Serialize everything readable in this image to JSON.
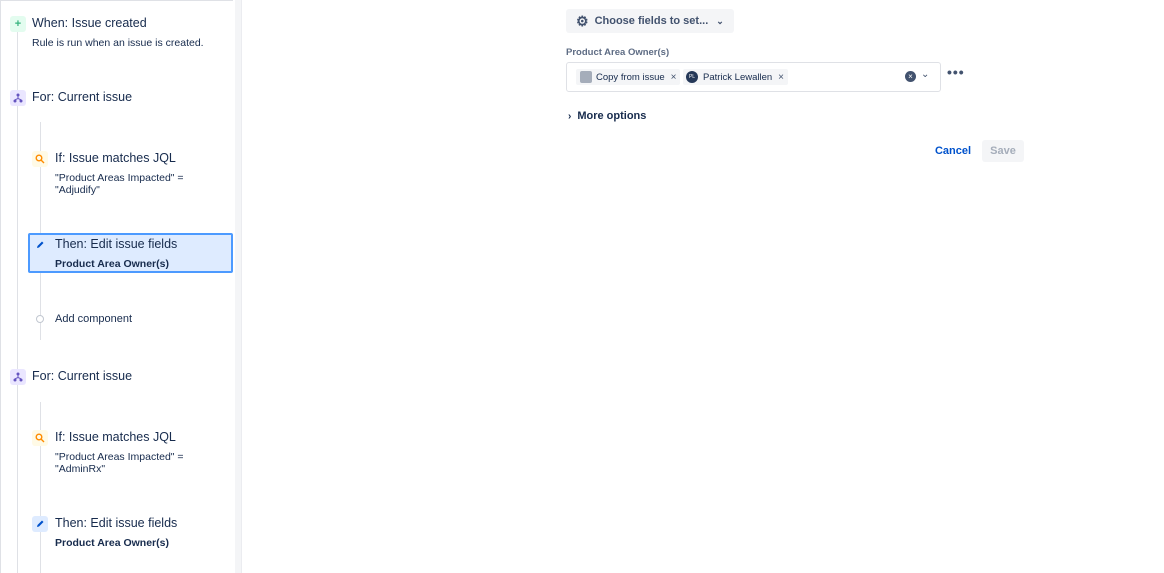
{
  "rule": {
    "trigger": {
      "title": "When: Issue created",
      "subtitle": "Rule is run when an issue is created.",
      "icon": "plus-icon"
    },
    "branch1": {
      "title": "For: Current issue",
      "icon": "branch-icon",
      "condition": {
        "title": "If: Issue matches JQL",
        "line1": "\"Product Areas Impacted\" =",
        "line2": "\"Adjudify\"",
        "icon": "search-icon"
      },
      "action": {
        "title": "Then: Edit issue fields",
        "subtitle": "Product Area Owner(s)",
        "icon": "pencil-icon",
        "selected": true
      },
      "add_component": "Add component"
    },
    "branch2": {
      "title": "For: Current issue",
      "icon": "branch-icon",
      "condition": {
        "title": "If: Issue matches JQL",
        "line1": "\"Product Areas Impacted\" =",
        "line2": "\"AdminRx\"",
        "icon": "search-icon"
      },
      "action": {
        "title": "Then: Edit issue fields",
        "subtitle": "Product Area Owner(s)",
        "icon": "pencil-icon"
      }
    }
  },
  "editor": {
    "choose_fields_label": "Choose fields to set...",
    "field_label": "Product Area Owner(s)",
    "chips": [
      {
        "label": "Copy from issue",
        "avatar": "user-placeholder-icon"
      },
      {
        "label": "Patrick Lewallen",
        "avatar": "avatar-initials",
        "initials": "PL"
      }
    ],
    "more_options_label": "More options",
    "cancel_label": "Cancel",
    "save_label": "Save"
  },
  "colors": {
    "accent": "#0052cc",
    "selected_bg": "#deebff",
    "selected_border": "#4c9aff",
    "trigger_green": "#36b37e",
    "branch_purple": "#6554c0",
    "condition_orange": "#ff8b00"
  }
}
